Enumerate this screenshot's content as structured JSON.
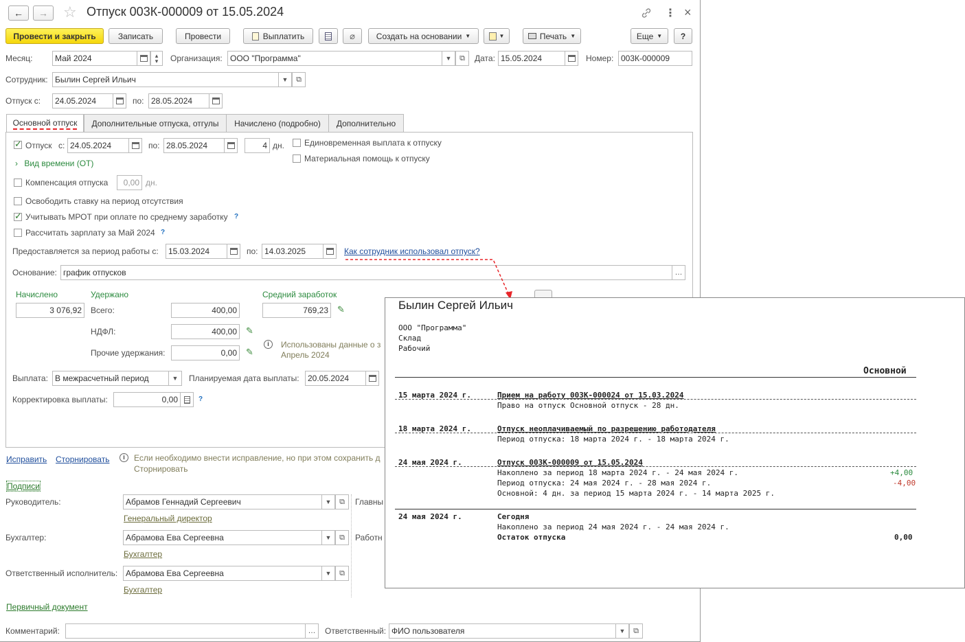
{
  "window": {
    "title": "Отпуск 003К-000009 от 15.05.2024",
    "back": "←",
    "forward": "→",
    "star": "☆",
    "link_icon": "🔗",
    "more": "⋮",
    "close": "×"
  },
  "toolbar": {
    "post_close": "Провести и закрыть",
    "save": "Записать",
    "post": "Провести",
    "pay": "Выплатить",
    "create_based": "Создать на основании",
    "print": "Печать",
    "more": "Еще",
    "help": "?"
  },
  "header": {
    "month_label": "Месяц:",
    "month_value": "Май 2024",
    "org_label": "Организация:",
    "org_value": "ООО \"Программа\"",
    "date_label": "Дата:",
    "date_value": "15.05.2024",
    "number_label": "Номер:",
    "number_value": "003К-000009",
    "employee_label": "Сотрудник:",
    "employee_value": "Былин Сергей Ильич",
    "vacation_from_label": "Отпуск с:",
    "vacation_from": "24.05.2024",
    "vacation_to_label": "по:",
    "vacation_to": "28.05.2024"
  },
  "tabs": [
    {
      "label": "Основной отпуск"
    },
    {
      "label": "Дополнительные отпуска, отгулы"
    },
    {
      "label": "Начислено (подробно)"
    },
    {
      "label": "Дополнительно"
    }
  ],
  "main_tab": {
    "vacation_label": "Отпуск",
    "from_label": "с:",
    "from": "24.05.2024",
    "to_label": "по:",
    "to": "28.05.2024",
    "days": "4",
    "days_unit": "дн.",
    "lump_sum": "Единовременная выплата к отпуску",
    "material_aid": "Материальная помощь к отпуску",
    "time_type": "Вид времени (ОТ)",
    "compensation_label": "Компенсация отпуска",
    "compensation_value": "0,00",
    "compensation_unit": "дн.",
    "free_rate": "Освободить ставку на период отсутствия",
    "mrot": "Учитывать МРОТ при оплате по среднему заработку",
    "calc_salary": "Рассчитать зарплату за Май 2024",
    "period_label": "Предоставляется за период работы с:",
    "period_from": "15.03.2024",
    "period_to_label": "по:",
    "period_to": "14.03.2025",
    "how_used_link": "Как сотрудник использовал отпуск?",
    "basis_label": "Основание:",
    "basis_value": "график отпусков",
    "accrued_label": "Начислено",
    "accrued_value": "3 076,92",
    "withheld_label": "Удержано",
    "total_label": "Всего:",
    "total_value": "400,00",
    "ndfl_label": "НДФЛ:",
    "ndfl_value": "400,00",
    "other_label": "Прочие удержания:",
    "other_value": "0,00",
    "avg_label": "Средний заработок",
    "avg_value": "769,23",
    "info_text_1": "Использованы данные о з",
    "info_text_2": "Апрель 2024",
    "payout_label": "Выплата:",
    "payout_value": "В межрасчетный период",
    "planned_date_label": "Планируемая дата выплаты:",
    "planned_date": "20.05.2024",
    "correction_label": "Корректировка выплаты:",
    "correction_value": "0,00"
  },
  "footer": {
    "fix_link": "Исправить",
    "reverse_link": "Сторнировать",
    "fix_info_1": "Если необходимо внести исправление, но при этом сохранить д",
    "fix_info_2": "Сторнировать",
    "signatures_link": "Подписи",
    "manager_label": "Руководитель:",
    "manager_value": "Абрамов Геннадий Сергеевич",
    "manager_position": "Генеральный директор",
    "chief_label": "Главны",
    "accountant_label": "Бухгалтер:",
    "accountant_value": "Абрамова Ева Сергеевна",
    "accountant_position": "Бухгалтер",
    "worker_label": "Работн",
    "responsible_label": "Ответственный исполнитель:",
    "responsible_value": "Абрамова Ева Сергеевна",
    "responsible_position": "Бухгалтер",
    "primary_doc_link": "Первичный документ",
    "comment_label": "Комментарий:",
    "comment_value": "",
    "owner_label": "Ответственный:",
    "owner_value": "ФИО пользователя"
  },
  "report": {
    "name": "Былин Сергей Ильич",
    "org": "ООО \"Программа\"",
    "dept": "Склад",
    "position": "Рабочий",
    "column": "Основной",
    "entries": [
      {
        "date": "15 марта 2024 г.",
        "doc": "Прием на работу 003К-000024 от 15.03.2024",
        "lines": [
          "Право на отпуск Основной отпуск - 28 дн."
        ],
        "values": []
      },
      {
        "date": "18 марта 2024 г.",
        "doc": "Отпуск неоплачиваемый по разрешению работодателя",
        "lines": [
          "Период отпуска: 18 марта 2024 г. - 18 марта 2024 г."
        ],
        "values": []
      },
      {
        "date": "24 мая 2024 г.",
        "doc": "Отпуск 003К-000009 от 15.05.2024",
        "lines": [
          "Накоплено за период 18 марта 2024 г. - 24 мая 2024 г.",
          "Период отпуска: 24 мая 2024 г. - 28 мая 2024 г.",
          "Основной: 4 дн. за период 15 марта 2024 г. - 14 марта 2025 г."
        ],
        "values": [
          "+4,00",
          "-4,00"
        ]
      }
    ],
    "today_date": "24 мая 2024 г.",
    "today_label": "Сегодня",
    "today_line": "Накоплено за период 24 мая 2024 г. - 24 мая 2024 г.",
    "balance_label": "Остаток отпуска",
    "balance_value": "0,00"
  },
  "colors": {
    "primary_button": "#f5d70b",
    "link": "#1f4e9c",
    "green_label": "#2b8a3e",
    "positive": "#2b8a3e",
    "negative": "#c0392b",
    "annotation": "#e8262a"
  }
}
